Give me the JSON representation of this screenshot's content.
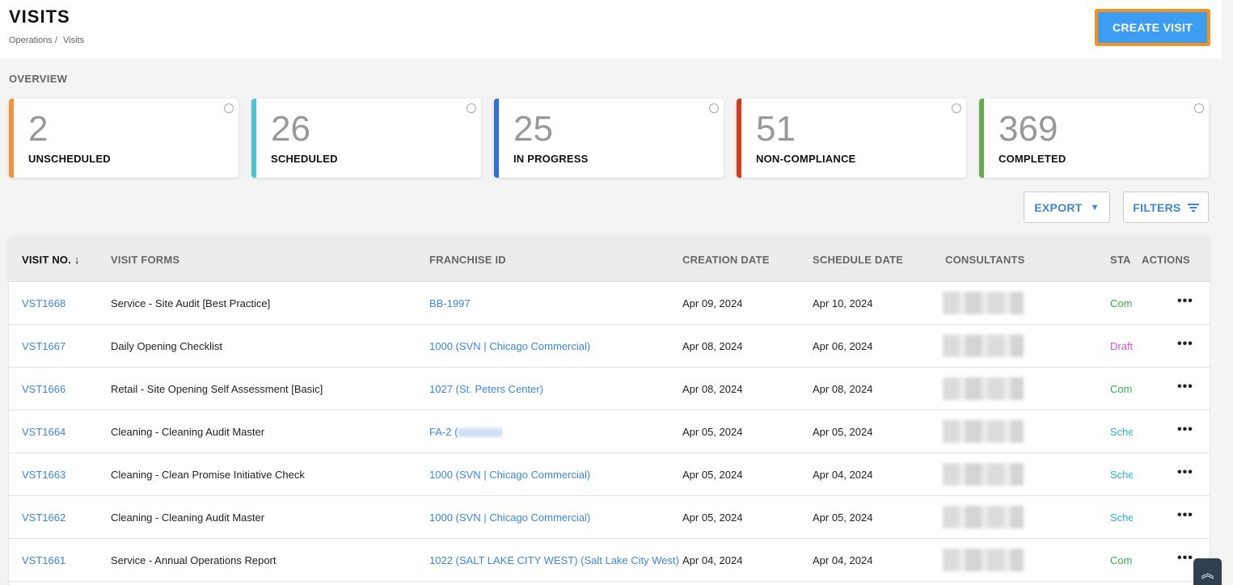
{
  "header": {
    "title": "VISITS",
    "breadcrumb": [
      "Operations /",
      "Visits"
    ],
    "create_label": "CREATE VISIT"
  },
  "overview": {
    "label": "OVERVIEW",
    "cards": [
      {
        "count": "2",
        "label": "UNSCHEDULED",
        "color": "#f5923e"
      },
      {
        "count": "26",
        "label": "SCHEDULED",
        "color": "#45c7d6"
      },
      {
        "count": "25",
        "label": "IN PROGRESS",
        "color": "#2f6fe0"
      },
      {
        "count": "51",
        "label": "NON-COMPLIANCE",
        "color": "#d93a1e"
      },
      {
        "count": "369",
        "label": "COMPLETED",
        "color": "#6aa84f"
      }
    ]
  },
  "toolbar": {
    "export_label": "EXPORT",
    "filters_label": "FILTERS"
  },
  "table": {
    "columns": [
      "VISIT NO.",
      "VISIT FORMS",
      "FRANCHISE ID",
      "CREATION DATE",
      "SCHEDULE DATE",
      "CONSULTANTS",
      "STA",
      "ACTIONS"
    ],
    "sort_arrow": "↓",
    "rows": [
      {
        "visit": "VST1668",
        "form": "Service - Site Audit [Best Practice]",
        "franchise": "BB-1997",
        "created": "Apr 09, 2024",
        "scheduled": "Apr 10, 2024",
        "status": "Com",
        "status_color": "#3aa856"
      },
      {
        "visit": "VST1667",
        "form": "Daily Opening Checklist",
        "franchise": "1000 (SVN | Chicago Commercial)",
        "created": "Apr 08, 2024",
        "scheduled": "Apr 06, 2024",
        "status": "Draft",
        "status_color": "#c45ad6"
      },
      {
        "visit": "VST1666",
        "form": "Retail - Site Opening Self Assessment [Basic]",
        "franchise": "1027 (St. Peters Center)",
        "created": "Apr 08, 2024",
        "scheduled": "Apr 08, 2024",
        "status": "Com",
        "status_color": "#3aa856"
      },
      {
        "visit": "VST1664",
        "form": "Cleaning - Cleaning Audit Master",
        "franchise": "FA-2 (",
        "created": "Apr 05, 2024",
        "scheduled": "Apr 05, 2024",
        "status": "Sche",
        "status_color": "#2bb3c8"
      },
      {
        "visit": "VST1663",
        "form": "Cleaning - Clean Promise Initiative Check",
        "franchise": "1000 (SVN | Chicago Commercial)",
        "created": "Apr 05, 2024",
        "scheduled": "Apr 04, 2024",
        "status": "Sche",
        "status_color": "#2bb3c8"
      },
      {
        "visit": "VST1662",
        "form": "Cleaning - Cleaning Audit Master",
        "franchise": "1000 (SVN | Chicago Commercial)",
        "created": "Apr 05, 2024",
        "scheduled": "Apr 05, 2024",
        "status": "Sche",
        "status_color": "#2bb3c8"
      },
      {
        "visit": "VST1661",
        "form": "Service - Annual Operations Report",
        "franchise": "1022 (SALT LAKE CITY WEST) (Salt Lake City West)",
        "created": "Apr 04, 2024",
        "scheduled": "Apr 04, 2024",
        "status": "Com",
        "status_color": "#3aa856"
      }
    ]
  },
  "actions_icon": "more-horizontal-icon",
  "scroll_icon": "double-chevron-up-icon"
}
